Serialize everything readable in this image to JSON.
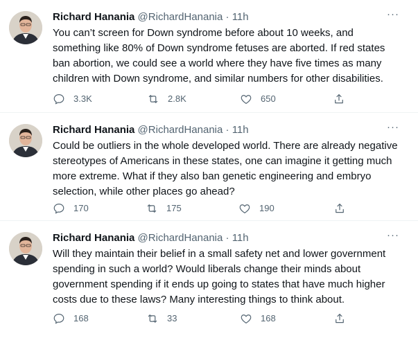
{
  "tweets": [
    {
      "author_name": "Richard Hanania",
      "handle": "@RichardHanania",
      "separator": "·",
      "time": "11h",
      "more_label": "···",
      "text": "You can’t screen for Down syndrome before about 10 weeks, and\nsomething like 80% of Down syndrome fetuses are aborted. If red states\nban abortion, we could see a world where they have five times as many\nchildren with Down syndrome, and similar numbers for other disabilities.",
      "replies": "3.3K",
      "retweets": "2.8K",
      "likes": "650"
    },
    {
      "author_name": "Richard Hanania",
      "handle": "@RichardHanania",
      "separator": "·",
      "time": "11h",
      "more_label": "···",
      "text": "Could be outliers in the whole developed world. There are already negative\nstereotypes of Americans in these states, one can imagine it getting much\nmore extreme. What if they also ban genetic engineering and embryo\nselection, while other places go ahead?",
      "replies": "170",
      "retweets": "175",
      "likes": "190"
    },
    {
      "author_name": "Richard Hanania",
      "handle": "@RichardHanania",
      "separator": "·",
      "time": "11h",
      "more_label": "···",
      "text": "Will they maintain their belief in a small safety net and lower government\nspending in such a world? Would liberals change their minds about\ngovernment spending if it ends up going to states that have much higher\ncosts due to these laws? Many interesting things to think about.",
      "replies": "168",
      "retweets": "33",
      "likes": "168"
    }
  ],
  "colors": {
    "text_primary": "#0f1419",
    "text_secondary": "#536471",
    "divider": "#eff3f4",
    "background": "#ffffff"
  },
  "icons": [
    "avatar",
    "more-icon",
    "reply-icon",
    "retweet-icon",
    "like-icon",
    "share-icon"
  ]
}
